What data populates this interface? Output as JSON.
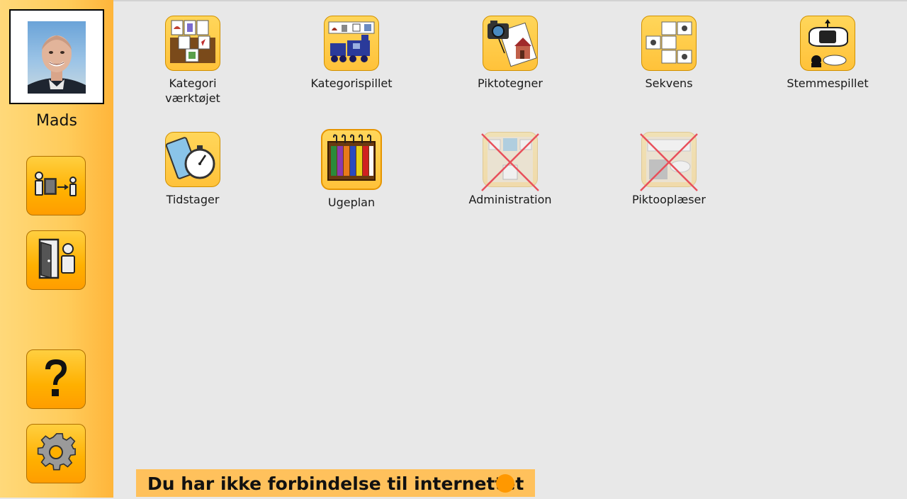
{
  "sidebar": {
    "user_name": "Mads",
    "buttons": [
      {
        "icon": "switch-user-icon"
      },
      {
        "icon": "logout-door-icon"
      },
      {
        "icon": "help-question-icon"
      },
      {
        "icon": "settings-gear-icon"
      }
    ]
  },
  "apps": [
    {
      "label": "Kategori\nværktøjet",
      "icon": "category-tool-icon",
      "state": "normal"
    },
    {
      "label": "Kategorispillet",
      "icon": "category-game-train-icon",
      "state": "normal"
    },
    {
      "label": "Piktotegner",
      "icon": "pictogram-drawer-camera-icon",
      "state": "normal"
    },
    {
      "label": "Sekvens",
      "icon": "sequence-icon",
      "state": "normal"
    },
    {
      "label": "Stemmespillet",
      "icon": "voice-game-car-icon",
      "state": "normal"
    },
    {
      "label": "Tidstager",
      "icon": "timer-stopwatch-icon",
      "state": "normal"
    },
    {
      "label": "Ugeplan",
      "icon": "week-plan-icon",
      "state": "selected"
    },
    {
      "label": "Administration",
      "icon": "administration-icon",
      "state": "disabled"
    },
    {
      "label": "Piktooplæser",
      "icon": "pictogram-reader-icon",
      "state": "disabled"
    }
  ],
  "status": {
    "message": "Du har ikke forbindelse til internettet",
    "dot_color": "#ff9800"
  },
  "colors": {
    "sidebar": "#ffcb5a",
    "accent": "#ffb000",
    "background": "#e8e8e8",
    "banner": "#ffc15c",
    "disabled_cross": "#e8505b"
  }
}
